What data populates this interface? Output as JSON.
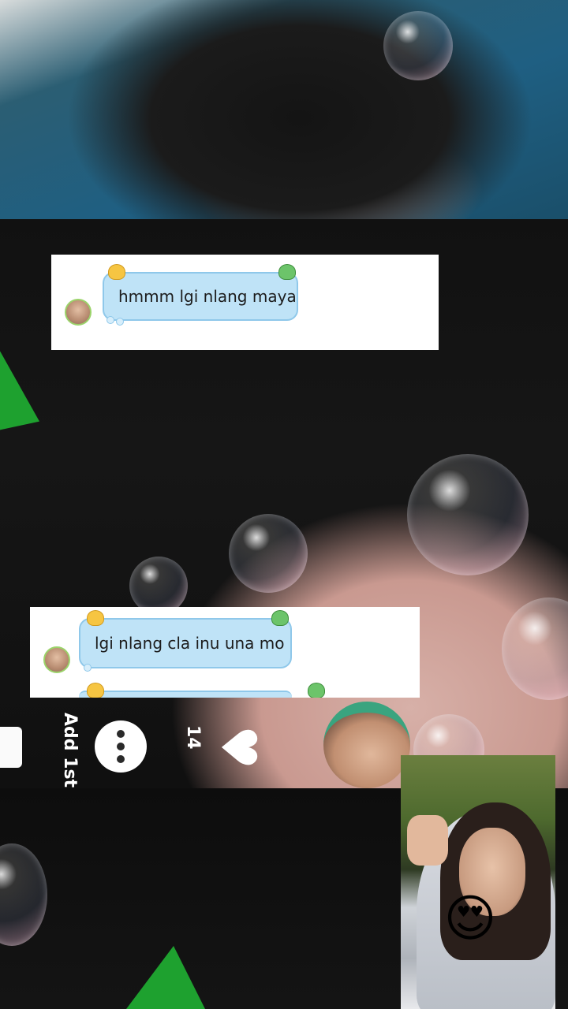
{
  "messages": [
    {
      "text": "hmmm lgi nlang maya"
    },
    {
      "text": "lgi nlang cla inu una mo"
    }
  ],
  "stats": {
    "first_label": "Add 1st",
    "like_count": "14"
  },
  "icons": {
    "chat": "comment-icon",
    "like": "heart-icon",
    "sticker_left": "chick-sticker-icon",
    "sticker_right": "frog-sticker-icon",
    "reaction": "heart-eyes-emoji"
  },
  "reaction_emoji": "😍",
  "heart_glyph": "♥",
  "colors": {
    "bubble_fill": "#bfe3f7",
    "bubble_border": "#8fc8ea",
    "accent_green": "#1ea12f"
  }
}
